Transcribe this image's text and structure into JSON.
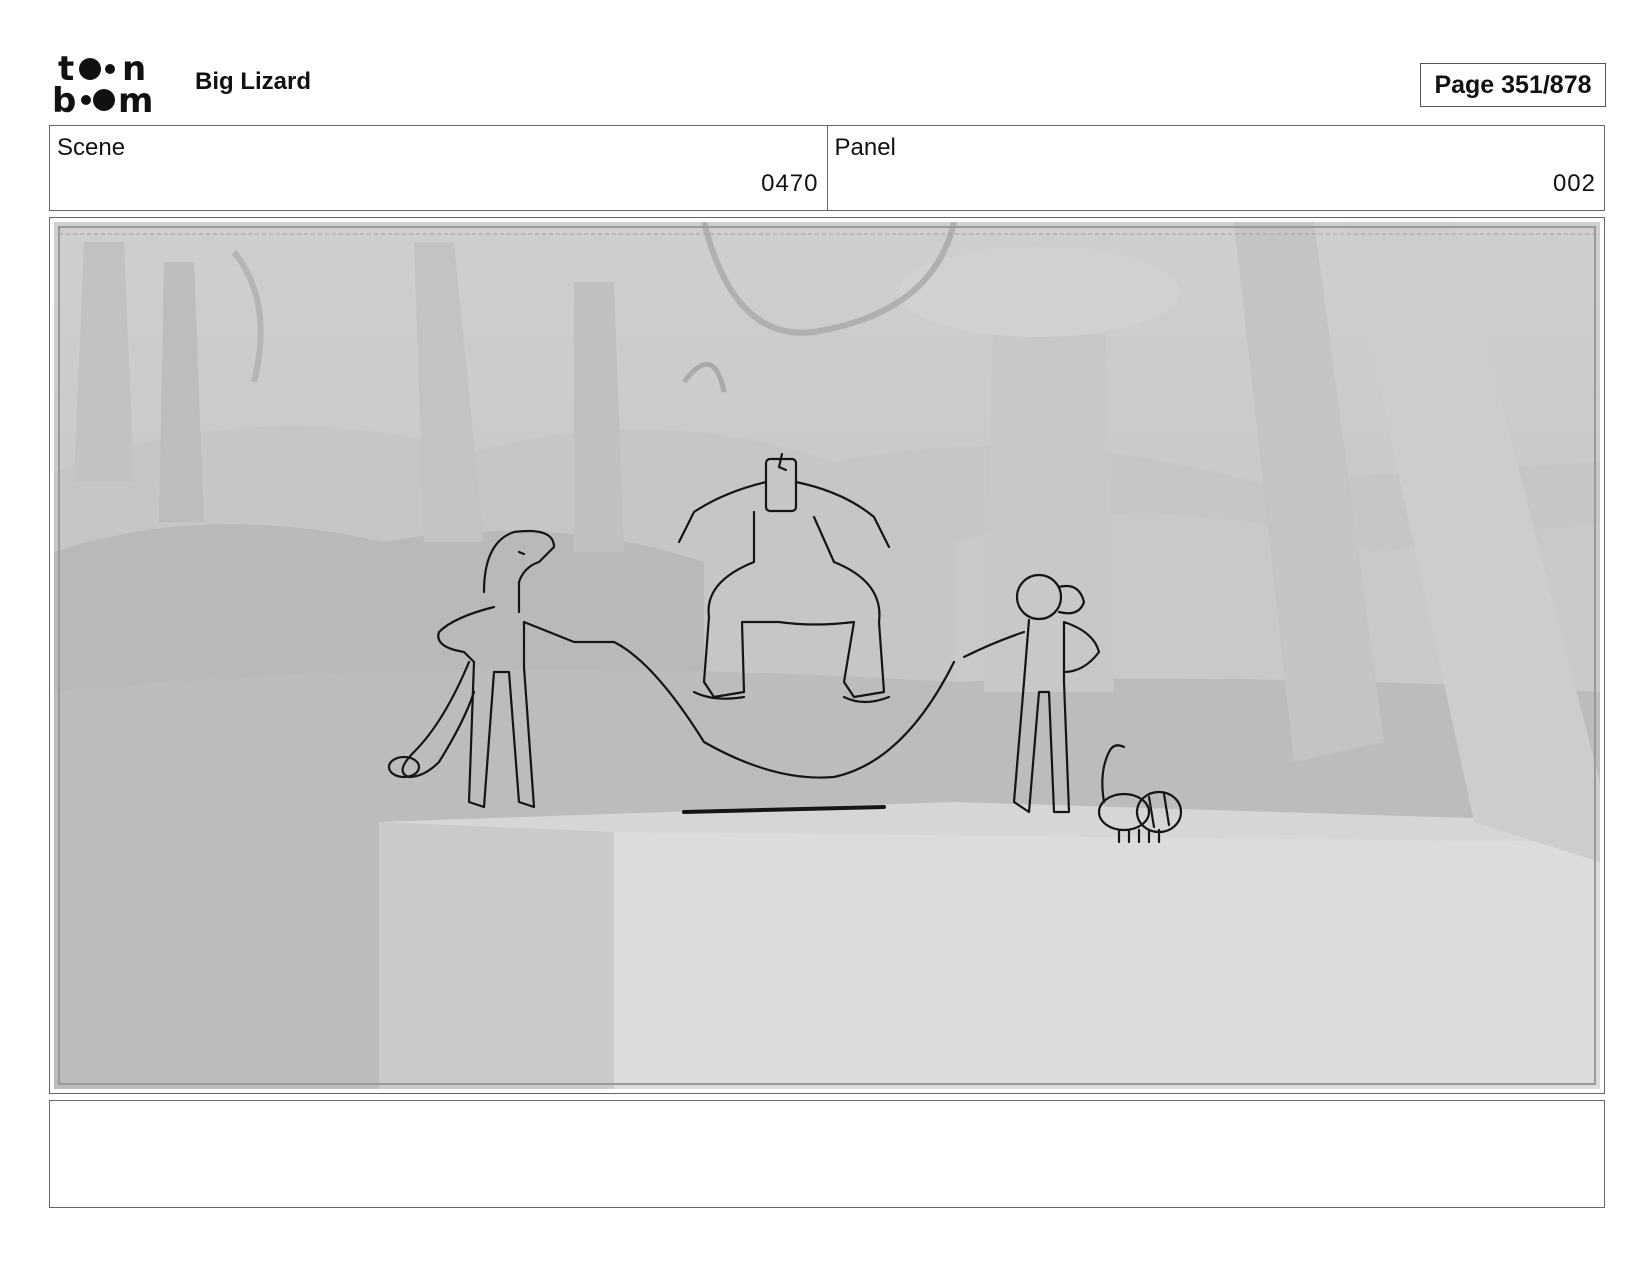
{
  "header": {
    "logo_text": "toon boom",
    "project_title": "Big Lizard",
    "page_label": "Page 351/878"
  },
  "meta": {
    "scene_label": "Scene",
    "scene_value": "0470",
    "panel_label": "Panel",
    "panel_value": "002"
  },
  "panel": {
    "image_name": "storyboard-panel-drawing"
  },
  "notes": {
    "text": ""
  }
}
